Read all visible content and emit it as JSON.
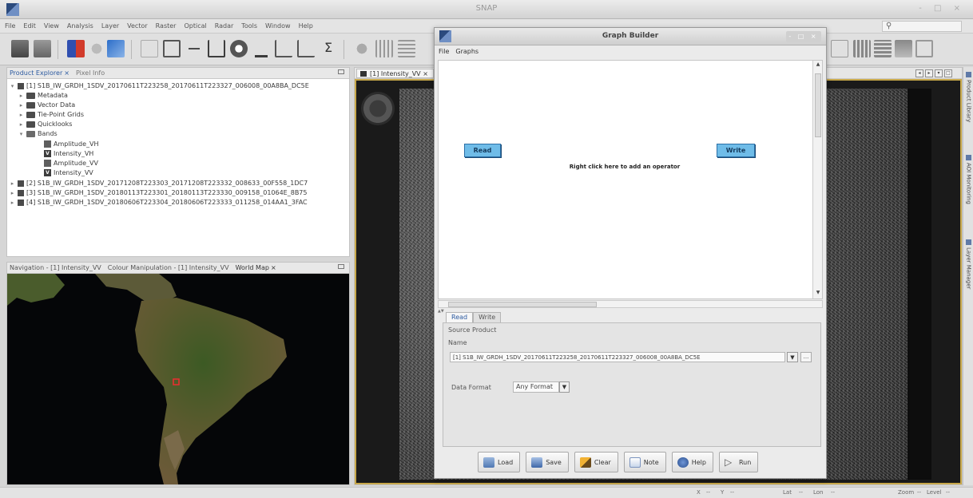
{
  "window": {
    "title": "SNAP",
    "controls": "- □ ×"
  },
  "menubar": {
    "items": [
      "File",
      "Edit",
      "View",
      "Analysis",
      "Layer",
      "Vector",
      "Raster",
      "Optical",
      "Radar",
      "Tools",
      "Window",
      "Help"
    ],
    "search_icon": "search-icon"
  },
  "product_explorer": {
    "tabs": [
      "Product Explorer",
      "Pixel Info"
    ],
    "tab_close": "×",
    "products": [
      "[1] S1B_IW_GRDH_1SDV_20170611T223258_20170611T223327_006008_00A8BA_DC5E",
      "[2] S1B_IW_GRDH_1SDV_20171208T223303_20171208T223332_008633_00F558_1DC7",
      "[3] S1B_IW_GRDH_1SDV_20180113T223301_20180113T223330_009158_01064E_8B75",
      "[4] S1B_IW_GRDH_1SDV_20180606T223304_20180606T223333_011258_014AA1_3FAC"
    ],
    "folders": [
      "Metadata",
      "Vector Data",
      "Tie-Point Grids",
      "Quicklooks",
      "Bands"
    ],
    "bands": [
      "Amplitude_VH",
      "Intensity_VH",
      "Amplitude_VV",
      "Intensity_VV"
    ]
  },
  "nav_panel": {
    "tabs": [
      "Navigation - [1] Intensity_VV",
      "Colour Manipulation - [1] Intensity_VV",
      "World Map"
    ],
    "tab_close": "×"
  },
  "image_view": {
    "tab_label": "[1] Intensity_VV",
    "tab_close": "×"
  },
  "right_strip": [
    "Product Library",
    "AOI Monitoring",
    "Layer Manager"
  ],
  "graph_builder": {
    "title": "Graph Builder",
    "menu": [
      "File",
      "Graphs"
    ],
    "nodes": {
      "read": "Read",
      "write": "Write"
    },
    "hint": "Right click here to add an operator",
    "tabs": [
      "Read",
      "Write"
    ],
    "source_product_label": "Source Product",
    "name_label": "Name",
    "source_value": "[1] S1B_IW_GRDH_1SDV_20170611T223258_20170611T223327_006008_00A8BA_DC5E",
    "more_label": "...",
    "data_format_label": "Data Format",
    "data_format_value": "Any Format",
    "buttons": [
      "Load",
      "Save",
      "Clear",
      "Note",
      "Help",
      "Run"
    ]
  },
  "statusbar": {
    "x": "X",
    "y": "Y",
    "lat": "Lat",
    "lon": "Lon",
    "zoom": "Zoom",
    "level": "Level",
    "dash": "--"
  },
  "colors": {
    "node_fill": "#6fbce8",
    "accent": "#2c5aa0",
    "map_marker": "#e53030"
  }
}
